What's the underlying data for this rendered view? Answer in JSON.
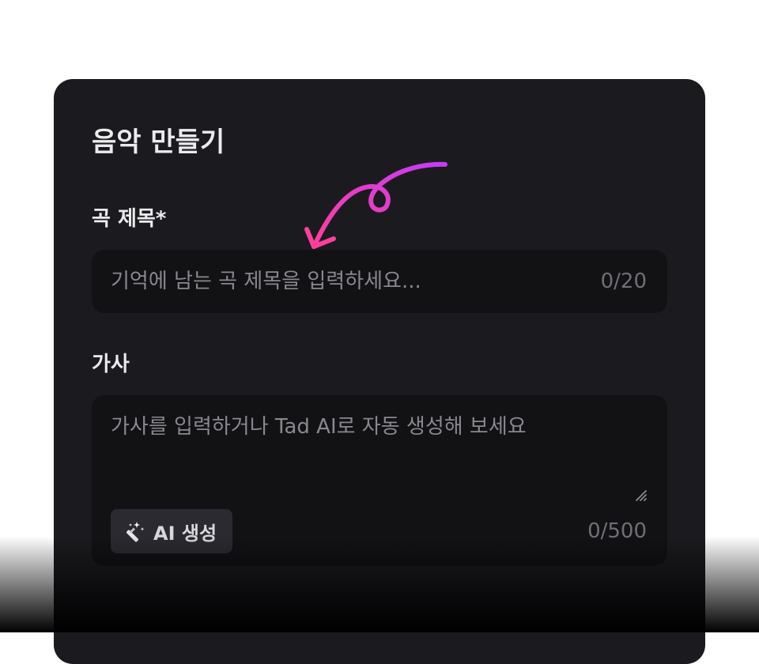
{
  "form": {
    "title": "음악 만들기",
    "song_title": {
      "label": "곡 제목*",
      "placeholder": "기억에 남는 곡 제목을 입력하세요...",
      "value": "",
      "counter": "0/20"
    },
    "lyrics": {
      "label": "가사",
      "placeholder": "가사를 입력하거나 Tad AI로 자동 생성해 보세요",
      "value": "",
      "counter": "0/500",
      "ai_button_label": "AI 생성",
      "ai_button_icon": "magic-wand-icon"
    }
  },
  "annotation": {
    "arrow_icon": "curly-arrow-icon",
    "arrow_gradient": [
      "#ff3f9b",
      "#c63cf5"
    ]
  },
  "colors": {
    "panel_bg": "#1b1b1f",
    "field_bg": "#121215",
    "text_primary": "#ebebee",
    "placeholder": "#88888e",
    "counter": "#6f6f75",
    "button_bg": "#2a2a30"
  }
}
